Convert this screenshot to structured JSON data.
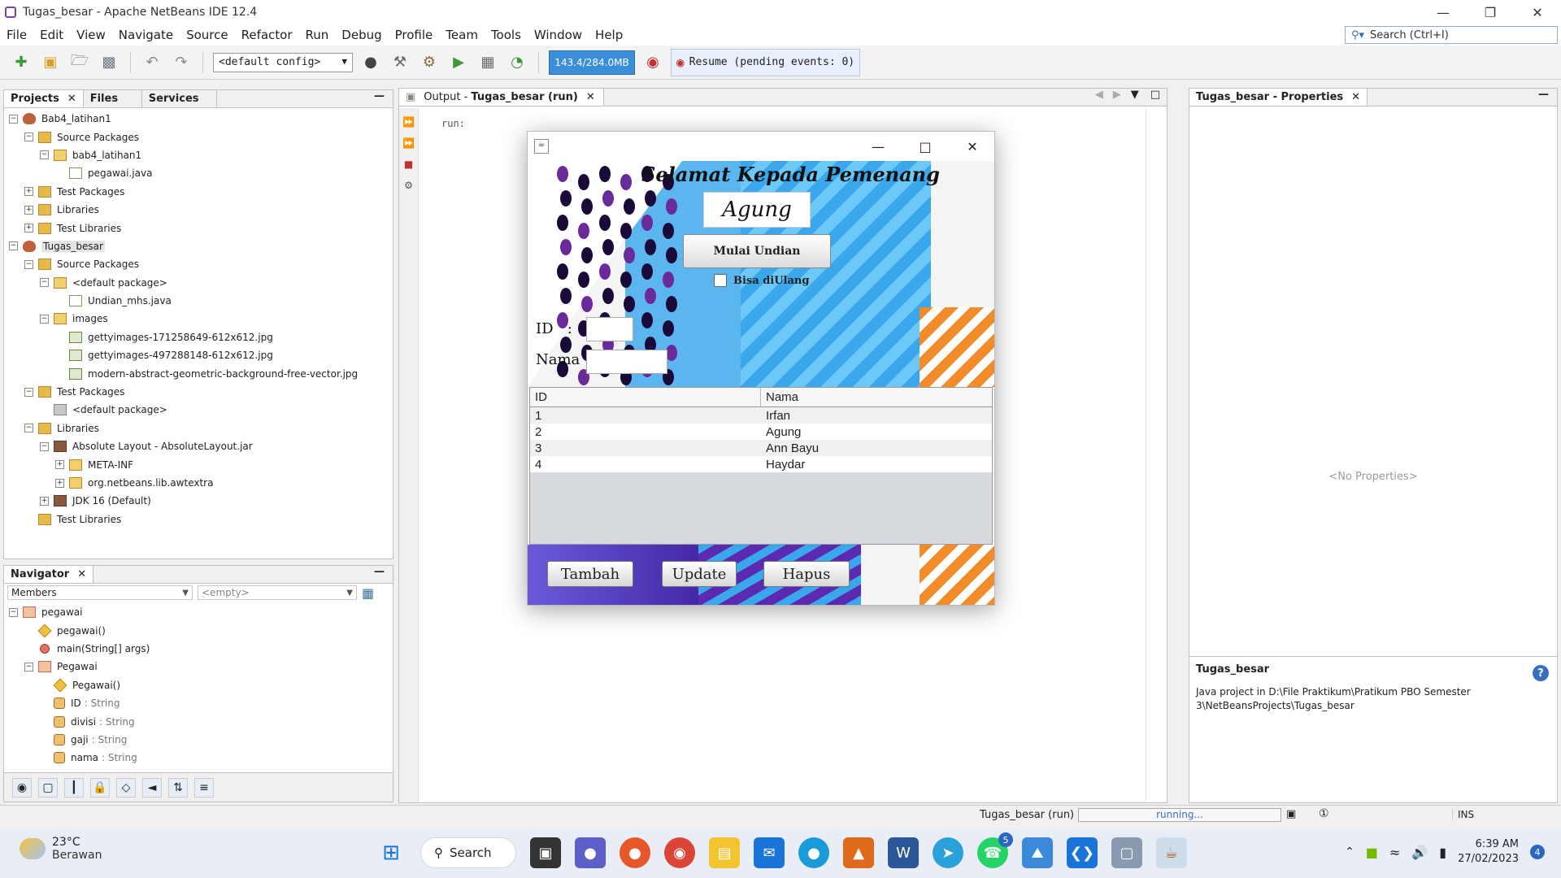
{
  "window": {
    "title": "Tugas_besar - Apache NetBeans IDE 12.4"
  },
  "menu": [
    "File",
    "Edit",
    "View",
    "Navigate",
    "Source",
    "Refactor",
    "Run",
    "Debug",
    "Profile",
    "Team",
    "Tools",
    "Window",
    "Help"
  ],
  "search": {
    "placeholder": "Search (Ctrl+I)"
  },
  "toolbar": {
    "config": "<default config>",
    "memory": "143.4/284.0MB",
    "resume": "Resume (pending events: 0)"
  },
  "projects_panel": {
    "tabs": [
      "Projects",
      "Files",
      "Services"
    ],
    "tree": [
      {
        "label": "Bab4_latihan1",
        "level": 0,
        "icon": "project-icon",
        "exp": "−"
      },
      {
        "label": "Source Packages",
        "level": 1,
        "icon": "folder-icon",
        "exp": "−"
      },
      {
        "label": "bab4_latihan1",
        "level": 2,
        "icon": "package-icon",
        "exp": "−"
      },
      {
        "label": "pegawai.java",
        "level": 3,
        "icon": "java-file-icon",
        "exp": ""
      },
      {
        "label": "Test Packages",
        "level": 1,
        "icon": "folder-icon",
        "exp": "+"
      },
      {
        "label": "Libraries",
        "level": 1,
        "icon": "folder-icon",
        "exp": "+"
      },
      {
        "label": "Test Libraries",
        "level": 1,
        "icon": "folder-icon",
        "exp": "+"
      },
      {
        "label": "Tugas_besar",
        "level": 0,
        "icon": "project-icon",
        "exp": "−"
      },
      {
        "label": "Source Packages",
        "level": 1,
        "icon": "folder-icon",
        "exp": "−"
      },
      {
        "label": "<default package>",
        "level": 2,
        "icon": "package-icon",
        "exp": "−"
      },
      {
        "label": "Undian_mhs.java",
        "level": 3,
        "icon": "java-file-icon",
        "exp": ""
      },
      {
        "label": "images",
        "level": 2,
        "icon": "package-icon",
        "exp": "−"
      },
      {
        "label": "gettyimages-171258649-612x612.jpg",
        "level": 3,
        "icon": "image-file-icon",
        "exp": ""
      },
      {
        "label": "gettyimages-497288148-612x612.jpg",
        "level": 3,
        "icon": "image-file-icon",
        "exp": ""
      },
      {
        "label": "modern-abstract-geometric-background-free-vector.jpg",
        "level": 3,
        "icon": "image-file-icon",
        "exp": ""
      },
      {
        "label": "Test Packages",
        "level": 1,
        "icon": "folder-icon",
        "exp": "−"
      },
      {
        "label": "<default package>",
        "level": 2,
        "icon": "empty-package-icon",
        "exp": ""
      },
      {
        "label": "Libraries",
        "level": 1,
        "icon": "folder-icon",
        "exp": "−"
      },
      {
        "label": "Absolute Layout - AbsoluteLayout.jar",
        "level": 2,
        "icon": "jar-icon",
        "exp": "−"
      },
      {
        "label": "META-INF",
        "level": 3,
        "icon": "package-icon",
        "exp": "+"
      },
      {
        "label": "org.netbeans.lib.awtextra",
        "level": 3,
        "icon": "package-icon",
        "exp": "+"
      },
      {
        "label": "JDK 16 (Default)",
        "level": 2,
        "icon": "jdk-icon",
        "exp": "+"
      },
      {
        "label": "Test Libraries",
        "level": 1,
        "icon": "folder-icon",
        "exp": ""
      }
    ]
  },
  "navigator": {
    "tab": "Navigator",
    "members": "Members",
    "filter": "<empty>",
    "tree": [
      {
        "label": "pegawai",
        "type": "",
        "level": 0,
        "icon": "class-icon",
        "exp": "−"
      },
      {
        "label": "pegawai()",
        "type": "",
        "level": 1,
        "icon": "constructor-icon",
        "exp": ""
      },
      {
        "label": "main(String[] args)",
        "type": "",
        "level": 1,
        "icon": "static-method-icon",
        "exp": ""
      },
      {
        "label": "Pegawai",
        "type": "",
        "level": 1,
        "icon": "class-icon",
        "exp": "−"
      },
      {
        "label": "Pegawai()",
        "type": "",
        "level": 2,
        "icon": "constructor-icon",
        "exp": ""
      },
      {
        "label": "ID",
        "type": ": String",
        "level": 2,
        "icon": "field-icon",
        "exp": ""
      },
      {
        "label": "divisi",
        "type": ": String",
        "level": 2,
        "icon": "field-icon",
        "exp": ""
      },
      {
        "label": "gaji",
        "type": ": String",
        "level": 2,
        "icon": "field-icon",
        "exp": ""
      },
      {
        "label": "nama",
        "type": ": String",
        "level": 2,
        "icon": "field-icon",
        "exp": ""
      }
    ]
  },
  "output": {
    "tab": "Output - ",
    "tab_bold": "Tugas_besar (run)",
    "text": "run:"
  },
  "properties": {
    "tab": "Tugas_besar - Properties",
    "empty": "<No Properties>",
    "desc_title": "Tugas_besar",
    "desc": "Java project in D:\\File Praktikum\\Pratikum PBO Semester 3\\NetBeansProjects\\Tugas_besar"
  },
  "app": {
    "greeting": "Selamat Kepada Pemenang",
    "winner": "Agung",
    "draw_button": "Mulai Undian",
    "repeat_checkbox": "Bisa diUlang",
    "id_label": "ID   :",
    "nama_label": "Nama :",
    "table": {
      "headers": [
        "ID",
        "Nama"
      ],
      "rows": [
        [
          "1",
          "Irfan"
        ],
        [
          "2",
          "Agung"
        ],
        [
          "3",
          "Ann Bayu"
        ],
        [
          "4",
          "Haydar"
        ]
      ]
    },
    "buttons": [
      "Tambah",
      "Update",
      "Hapus"
    ]
  },
  "status": {
    "run": "Tugas_besar (run)",
    "progress": "running...",
    "mode": "INS"
  },
  "taskbar": {
    "temp": "23°C",
    "weather": "Berawan",
    "search": "Search",
    "time": "6:39 AM",
    "date": "27/02/2023",
    "notif": "4",
    "whatsapp_badge": "5"
  }
}
